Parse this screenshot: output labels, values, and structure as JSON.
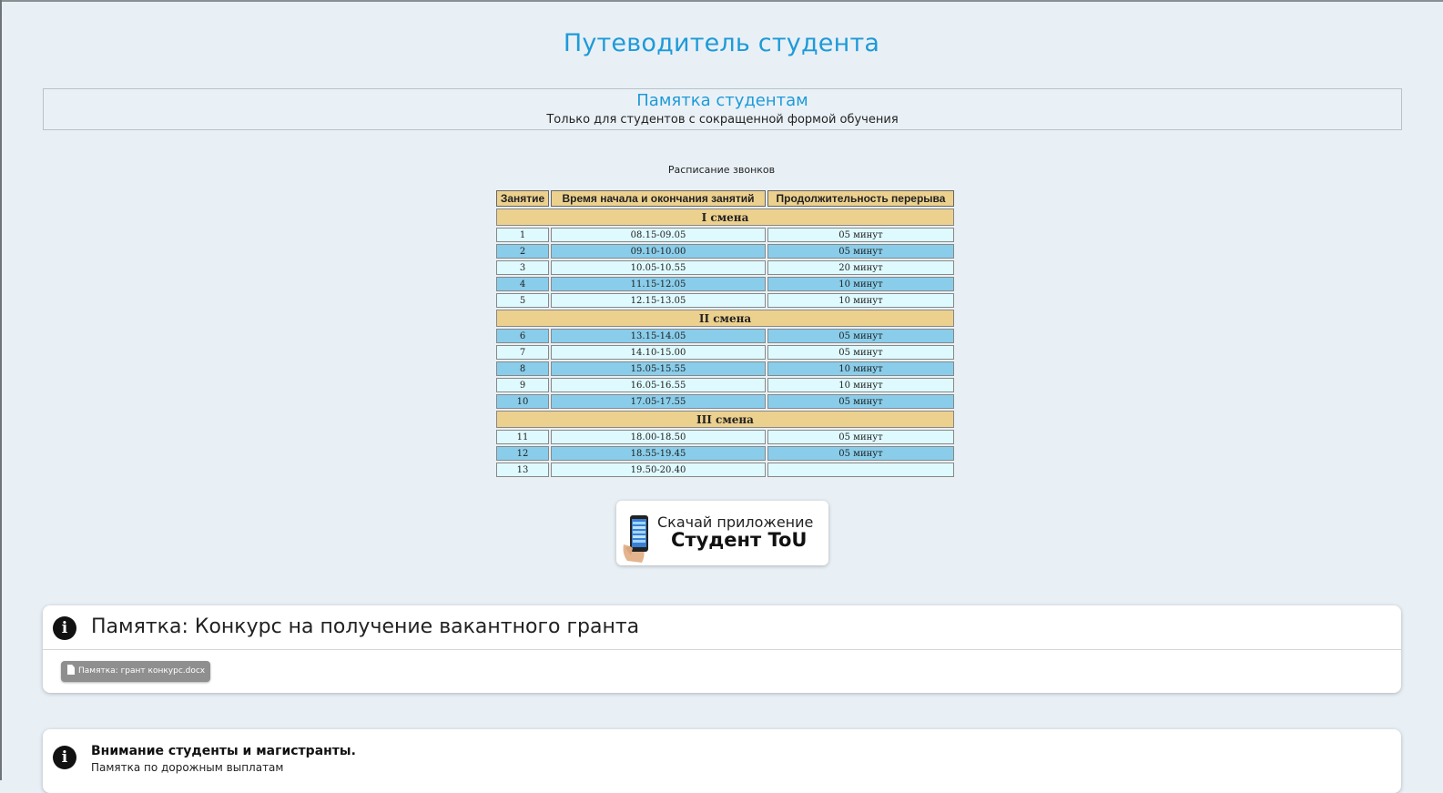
{
  "page_title": "Путеводитель студента",
  "memo": {
    "title": "Памятка студентам",
    "subtitle": "Только для студентов с сокращенной формой обучения"
  },
  "schedule": {
    "caption": "Расписание звонков",
    "headers": [
      "Занятие",
      "Время начала и окончания занятий",
      "Продолжительность перерыва"
    ],
    "shifts": [
      {
        "label": "I смена",
        "rows": [
          {
            "n": "1",
            "time": "08.15-09.05",
            "break": "05 минут"
          },
          {
            "n": "2",
            "time": "09.10-10.00",
            "break": "05 минут"
          },
          {
            "n": "3",
            "time": "10.05-10.55",
            "break": "20 минут"
          },
          {
            "n": "4",
            "time": "11.15-12.05",
            "break": "10 минут"
          },
          {
            "n": "5",
            "time": "12.15-13.05",
            "break": "10 минут"
          }
        ]
      },
      {
        "label": "II смена",
        "rows": [
          {
            "n": "6",
            "time": "13.15-14.05",
            "break": "05 минут"
          },
          {
            "n": "7",
            "time": "14.10-15.00",
            "break": "05 минут"
          },
          {
            "n": "8",
            "time": "15.05-15.55",
            "break": "10 минут"
          },
          {
            "n": "9",
            "time": "16.05-16.55",
            "break": "10 минут"
          },
          {
            "n": "10",
            "time": "17.05-17.55",
            "break": "05 минут"
          }
        ]
      },
      {
        "label": "III смена",
        "rows": [
          {
            "n": "11",
            "time": "18.00-18.50",
            "break": "05 минут"
          },
          {
            "n": "12",
            "time": "18.55-19.45",
            "break": "05 минут"
          },
          {
            "n": "13",
            "time": "19.50-20.40",
            "break": ""
          }
        ]
      }
    ],
    "colors": {
      "header": "#ecd08e",
      "row_light": "#dffaff",
      "row_blue": "#89cdea"
    }
  },
  "app_banner": {
    "line1": "Скачай приложение",
    "line2": "Студент ToU",
    "icon": "phone-in-hand-icon"
  },
  "cards": [
    {
      "icon": "info-icon",
      "title": "Памятка: Конкурс на получение вакантного гранта",
      "file": {
        "icon": "file-icon",
        "name": "Памятка: грант конкурс.docx"
      }
    },
    {
      "icon": "info-icon",
      "title": "Внимание студенты и магистранты.",
      "subtitle": "Памятка по дорожным выплатам"
    }
  ],
  "colors": {
    "accent": "#1e9ad8",
    "background": "#e8f0f6"
  }
}
